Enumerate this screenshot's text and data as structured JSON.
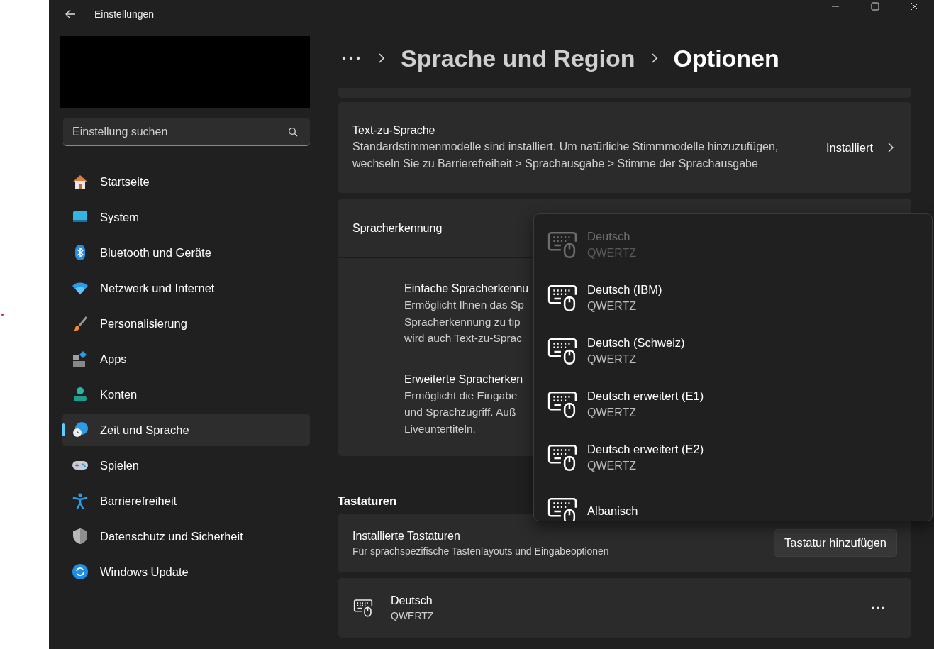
{
  "window": {
    "title": "Einstellungen"
  },
  "search": {
    "placeholder": "Einstellung suchen"
  },
  "sidebar": {
    "items": [
      {
        "label": "Startseite",
        "selected": false
      },
      {
        "label": "System",
        "selected": false
      },
      {
        "label": "Bluetooth und Geräte",
        "selected": false
      },
      {
        "label": "Netzwerk und Internet",
        "selected": false
      },
      {
        "label": "Personalisierung",
        "selected": false
      },
      {
        "label": "Apps",
        "selected": false
      },
      {
        "label": "Konten",
        "selected": false
      },
      {
        "label": "Zeit und Sprache",
        "selected": true
      },
      {
        "label": "Spielen",
        "selected": false
      },
      {
        "label": "Barrierefreiheit",
        "selected": false
      },
      {
        "label": "Datenschutz und Sicherheit",
        "selected": false
      },
      {
        "label": "Windows Update",
        "selected": false
      }
    ]
  },
  "breadcrumb": [
    "Sprache und Region",
    "Optionen"
  ],
  "text_to_speech": {
    "title": "Text-zu-Sprache",
    "description": "Standardstimmenmodelle sind installiert. Um natürliche Stimmmodelle hinzuzufügen, wechseln Sie zu Barrierefreiheit > Sprachausgabe > Stimme der Sprachausgabe",
    "status": "Installiert"
  },
  "speech_recognition": {
    "title": "Spracherkennung",
    "options": [
      {
        "title": "Einfache Spracherkennu",
        "lines": [
          "Ermöglicht Ihnen das Sp",
          "Spracherkennung zu tip",
          "wird auch Text-zu-Sprac"
        ]
      },
      {
        "title": "Erweiterte Spracherken",
        "lines": [
          "Ermöglicht die Eingabe",
          "und Sprachzugriff. Auß",
          "Liveuntertiteln."
        ]
      }
    ]
  },
  "keyboards": {
    "heading": "Tastaturen",
    "installed_title": "Installierte Tastaturen",
    "installed_description": "Für sprachspezifische Tastenlayouts und Eingabeoptionen",
    "add_button": "Tastatur hinzufügen",
    "items": [
      {
        "name": "Deutsch",
        "layout": "QWERTZ"
      }
    ]
  },
  "dropdown": {
    "items": [
      {
        "name": "Deutsch",
        "layout": "QWERTZ",
        "disabled": true
      },
      {
        "name": "Deutsch (IBM)",
        "layout": "QWERTZ",
        "disabled": false
      },
      {
        "name": "Deutsch (Schweiz)",
        "layout": "QWERTZ",
        "disabled": false
      },
      {
        "name": "Deutsch erweitert (E1)",
        "layout": "QWERTZ",
        "disabled": false
      },
      {
        "name": "Deutsch erweitert (E2)",
        "layout": "QWERTZ",
        "disabled": false
      },
      {
        "name": "Albanisch",
        "disabled": false
      }
    ]
  }
}
